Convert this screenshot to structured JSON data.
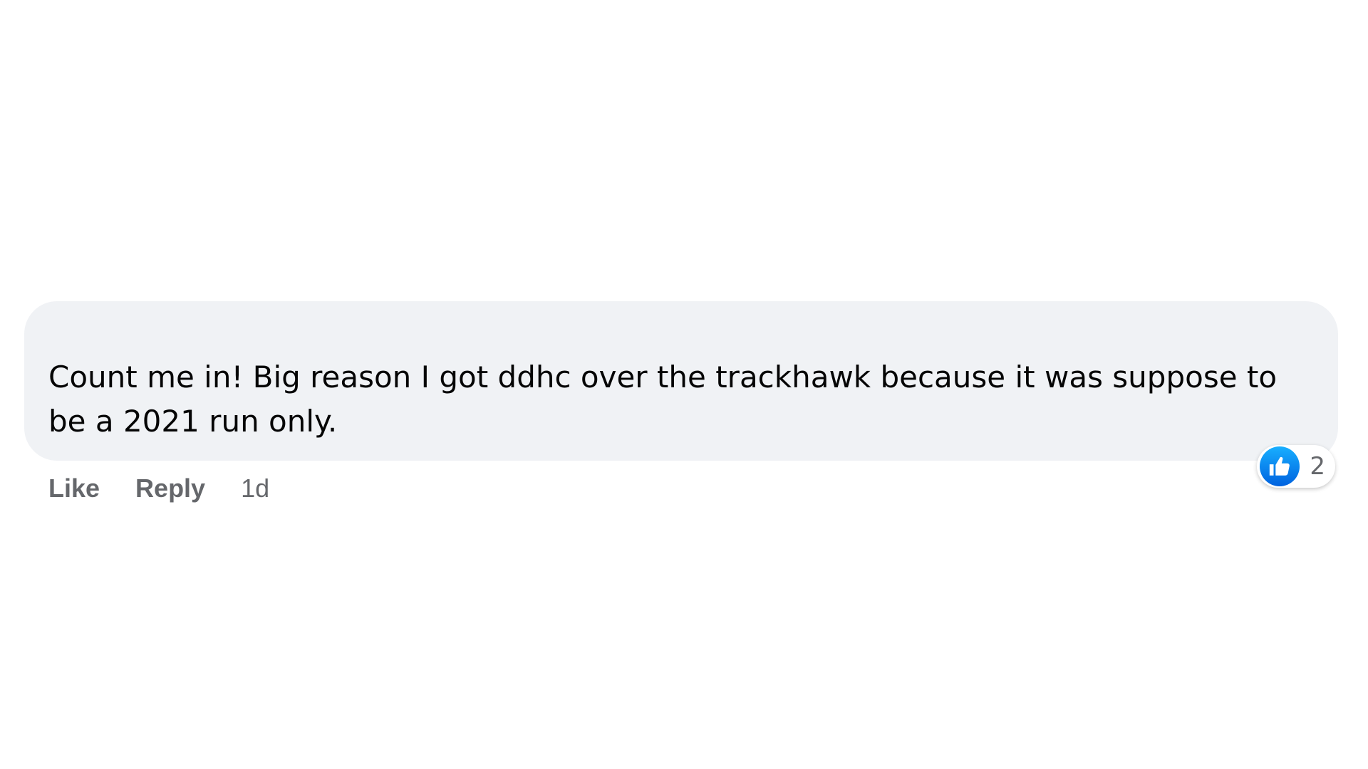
{
  "comment": {
    "text": "Count me in! Big reason I got ddhc over the trackhawk because it was suppose to be a 2021 run only.",
    "reactions": {
      "icon": "thumbs-up-icon",
      "count": "2"
    },
    "actions": {
      "like_label": "Like",
      "reply_label": "Reply",
      "timestamp": "1d"
    }
  },
  "colors": {
    "bubble_background": "#f0f2f5",
    "text": "#050505",
    "secondary_text": "#65676b",
    "like_blue": "#0866ff"
  }
}
